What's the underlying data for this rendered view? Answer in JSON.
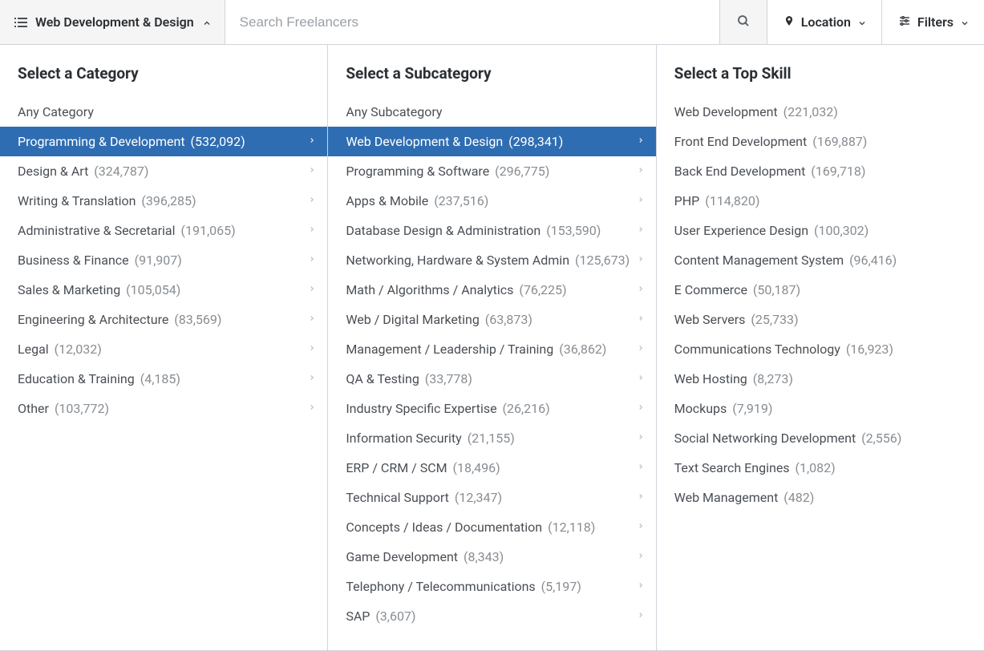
{
  "header": {
    "category_label": "Web Development & Design",
    "search_placeholder": "Search Freelancers",
    "location_label": "Location",
    "filters_label": "Filters"
  },
  "category_column": {
    "title": "Select a Category",
    "any_label": "Any Category",
    "items": [
      {
        "label": "Programming & Development",
        "count": "(532,092)",
        "selected": true
      },
      {
        "label": "Design & Art",
        "count": "(324,787)"
      },
      {
        "label": "Writing & Translation",
        "count": "(396,285)"
      },
      {
        "label": "Administrative & Secretarial",
        "count": "(191,065)"
      },
      {
        "label": "Business & Finance",
        "count": "(91,907)"
      },
      {
        "label": "Sales & Marketing",
        "count": "(105,054)"
      },
      {
        "label": "Engineering & Architecture",
        "count": "(83,569)"
      },
      {
        "label": "Legal",
        "count": "(12,032)"
      },
      {
        "label": "Education & Training",
        "count": "(4,185)"
      },
      {
        "label": "Other",
        "count": "(103,772)"
      }
    ]
  },
  "subcategory_column": {
    "title": "Select a Subcategory",
    "any_label": "Any Subcategory",
    "items": [
      {
        "label": "Web Development & Design",
        "count": "(298,341)",
        "selected": true
      },
      {
        "label": "Programming & Software",
        "count": "(296,775)"
      },
      {
        "label": "Apps & Mobile",
        "count": "(237,516)"
      },
      {
        "label": "Database Design & Administration",
        "count": "(153,590)"
      },
      {
        "label": "Networking, Hardware & System Admin",
        "count": "(125,673)"
      },
      {
        "label": "Math / Algorithms / Analytics",
        "count": "(76,225)"
      },
      {
        "label": "Web / Digital Marketing",
        "count": "(63,873)"
      },
      {
        "label": "Management / Leadership / Training",
        "count": "(36,862)"
      },
      {
        "label": "QA & Testing",
        "count": "(33,778)"
      },
      {
        "label": "Industry Specific Expertise",
        "count": "(26,216)"
      },
      {
        "label": "Information Security",
        "count": "(21,155)"
      },
      {
        "label": "ERP / CRM / SCM",
        "count": "(18,496)"
      },
      {
        "label": "Technical Support",
        "count": "(12,347)"
      },
      {
        "label": "Concepts / Ideas / Documentation",
        "count": "(12,118)"
      },
      {
        "label": "Game Development",
        "count": "(8,343)"
      },
      {
        "label": "Telephony / Telecommunications",
        "count": "(5,197)"
      },
      {
        "label": "SAP",
        "count": "(3,607)"
      }
    ]
  },
  "skill_column": {
    "title": "Select a Top Skill",
    "items": [
      {
        "label": "Web Development",
        "count": "(221,032)"
      },
      {
        "label": "Front End Development",
        "count": "(169,887)"
      },
      {
        "label": "Back End Development",
        "count": "(169,718)"
      },
      {
        "label": "PHP",
        "count": "(114,820)"
      },
      {
        "label": "User Experience Design",
        "count": "(100,302)"
      },
      {
        "label": "Content Management System",
        "count": "(96,416)"
      },
      {
        "label": "E Commerce",
        "count": "(50,187)"
      },
      {
        "label": "Web Servers",
        "count": "(25,733)"
      },
      {
        "label": "Communications Technology",
        "count": "(16,923)"
      },
      {
        "label": "Web Hosting",
        "count": "(8,273)"
      },
      {
        "label": "Mockups",
        "count": "(7,919)"
      },
      {
        "label": "Social Networking Development",
        "count": "(2,556)"
      },
      {
        "label": "Text Search Engines",
        "count": "(1,082)"
      },
      {
        "label": "Web Management",
        "count": "(482)"
      }
    ]
  }
}
